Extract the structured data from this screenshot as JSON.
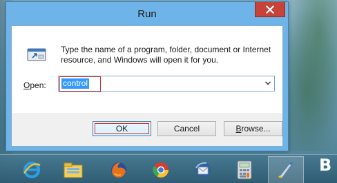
{
  "window": {
    "title": "Run",
    "description": "Type the name of a program, folder, document or Internet resource, and Windows will open it for you.",
    "open_label_prefix": "O",
    "open_label_rest": "pen:",
    "open_value": "control",
    "buttons": {
      "ok": "OK",
      "cancel": "Cancel",
      "browse_prefix": "B",
      "browse_rest": "rowse..."
    },
    "close_icon": "close-icon",
    "run_icon": "run-dialog-icon"
  },
  "taskbar": {
    "items": [
      {
        "name": "internet-explorer-icon"
      },
      {
        "name": "file-explorer-icon"
      },
      {
        "name": "firefox-icon"
      },
      {
        "name": "chrome-icon"
      },
      {
        "name": "thunderbird-icon"
      },
      {
        "name": "calculator-icon"
      },
      {
        "name": "paint-icon"
      }
    ],
    "cut_off_letter": "B"
  },
  "colors": {
    "title_bar": "#6fb4e8",
    "close_button": "#c7433a",
    "selection": "#3399ff",
    "highlight_box": "#d9302a"
  }
}
